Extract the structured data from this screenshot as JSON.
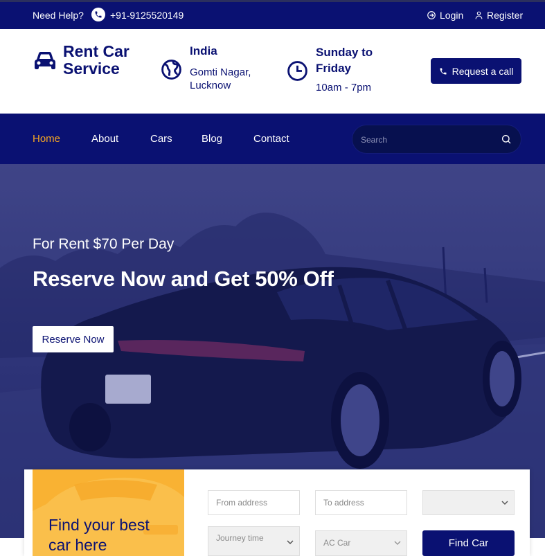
{
  "topbar": {
    "help_label": "Need Help?",
    "phone": "+91-9125520149",
    "login_label": "Login",
    "register_label": "Register"
  },
  "header": {
    "brand": "Rent Car Service",
    "location_title": "India",
    "location_sub": "Gomti Nagar, Lucknow",
    "hours_title": "Sunday to Friday",
    "hours_sub": "10am - 7pm",
    "request_call_label": "Request a call"
  },
  "nav": {
    "items": [
      "Home",
      "About",
      "Cars",
      "Blog",
      "Contact"
    ],
    "active": "Home",
    "search_placeholder": "Search"
  },
  "hero": {
    "subtitle": "For Rent $70 Per Day",
    "title": "Reserve Now and Get 50% Off",
    "button_label": "Reserve Now"
  },
  "booking": {
    "promo_title": "Find your best car here",
    "from_placeholder": "From address",
    "to_placeholder": "To address",
    "select_empty": "",
    "journey_time": "Journey time",
    "car_type": "AC Car",
    "find_label": "Find Car"
  },
  "colors": {
    "primary": "#0a1172",
    "accent": "#f5a623",
    "promo": "#f9b233"
  }
}
